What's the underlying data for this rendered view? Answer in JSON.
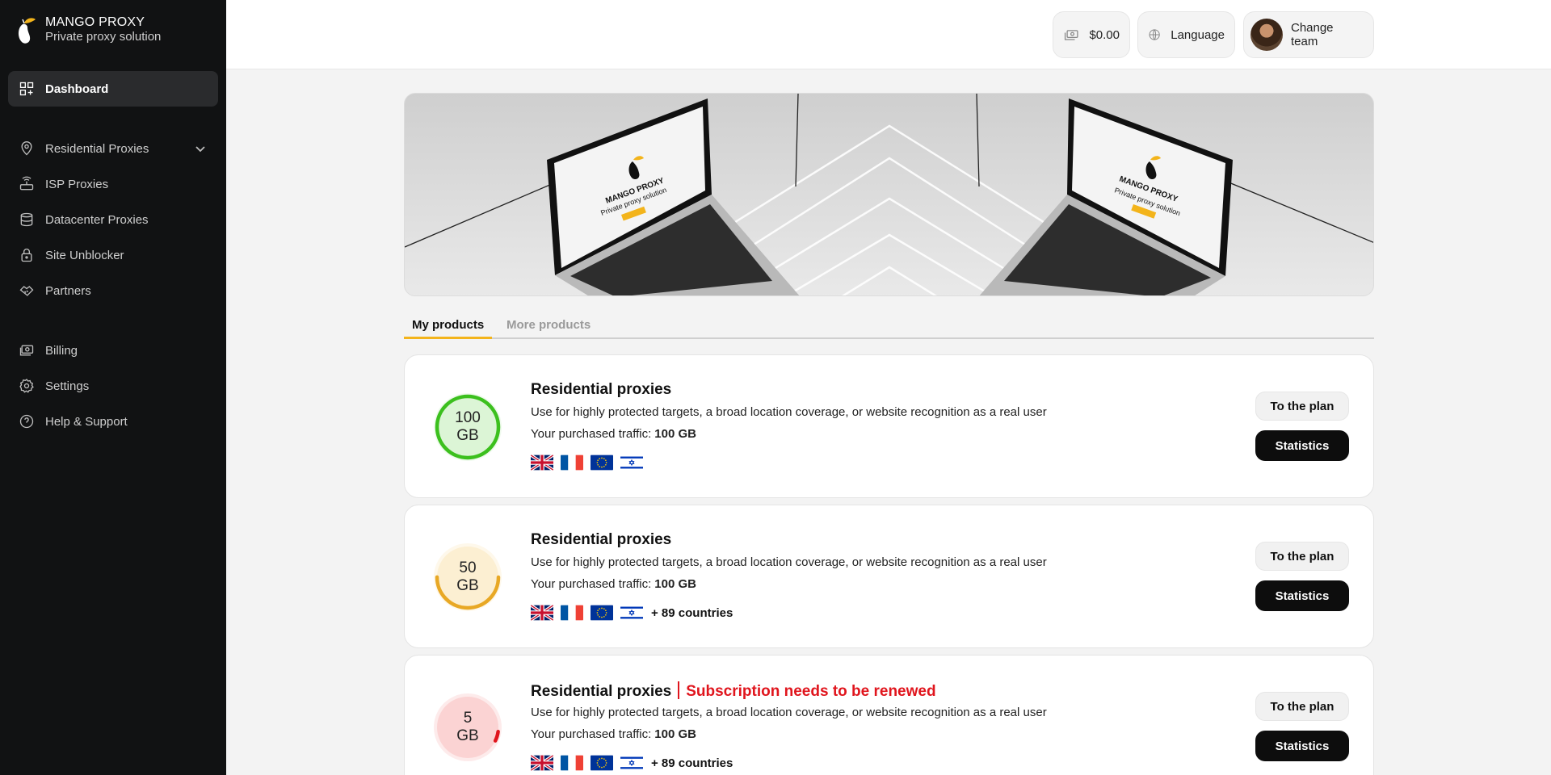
{
  "brand": {
    "name": "MANGO PROXY",
    "tagline": "Private proxy solution"
  },
  "sidebar": {
    "items": [
      {
        "label": "Dashboard",
        "icon": "dashboard-icon",
        "active": true
      },
      {
        "label": "Residential Proxies",
        "icon": "location-pin-icon",
        "expandable": true
      },
      {
        "label": "ISP Proxies",
        "icon": "router-icon"
      },
      {
        "label": "Datacenter Proxies",
        "icon": "database-icon"
      },
      {
        "label": "Site Unblocker",
        "icon": "lock-icon"
      },
      {
        "label": "Partners",
        "icon": "handshake-icon"
      },
      {
        "label": "Billing",
        "icon": "money-icon"
      },
      {
        "label": "Settings",
        "icon": "gear-icon"
      },
      {
        "label": "Help & Support",
        "icon": "help-icon"
      }
    ]
  },
  "topbar": {
    "balance": "$0.00",
    "language": "Language",
    "change_team": "Change team"
  },
  "tabs": [
    {
      "label": "My products",
      "active": true
    },
    {
      "label": "More products",
      "active": false
    }
  ],
  "products": [
    {
      "amount": "100",
      "unit": "GB",
      "progress": 1.0,
      "color": "#3cc01e",
      "bg": "#dcf5d6",
      "title": "Residential proxies",
      "warning": "",
      "description": "Use for highly protected targets, a broad location coverage, or website recognition as a real user",
      "traffic_label": "Your purchased traffic:",
      "traffic_value": "100 GB",
      "flags": [
        "gb",
        "fr",
        "eu",
        "il"
      ],
      "more_countries": "",
      "plan_label": "To the plan",
      "stats_label": "Statistics"
    },
    {
      "amount": "50",
      "unit": "GB",
      "progress": 0.5,
      "color": "#e8a825",
      "bg": "#fcefd2",
      "title": "Residential proxies",
      "warning": "",
      "description": "Use for highly protected targets, a broad location coverage, or website recognition as a real user",
      "traffic_label": "Your purchased traffic:",
      "traffic_value": "100 GB",
      "flags": [
        "gb",
        "fr",
        "eu",
        "il"
      ],
      "more_countries": "+ 89 countries",
      "plan_label": "To the plan",
      "stats_label": "Statistics"
    },
    {
      "amount": "5",
      "unit": "GB",
      "progress": 0.05,
      "color": "#e0151d",
      "bg": "#fbd3d3",
      "title": "Residential proxies",
      "warning": "Subscription needs to be renewed",
      "description": "Use for highly protected targets, a broad location coverage, or website recognition as a real user",
      "traffic_label": "Your purchased traffic:",
      "traffic_value": "100 GB",
      "flags": [
        "gb",
        "fr",
        "eu",
        "il"
      ],
      "more_countries": "+ 89 countries",
      "plan_label": "To the plan",
      "stats_label": "Statistics"
    }
  ]
}
